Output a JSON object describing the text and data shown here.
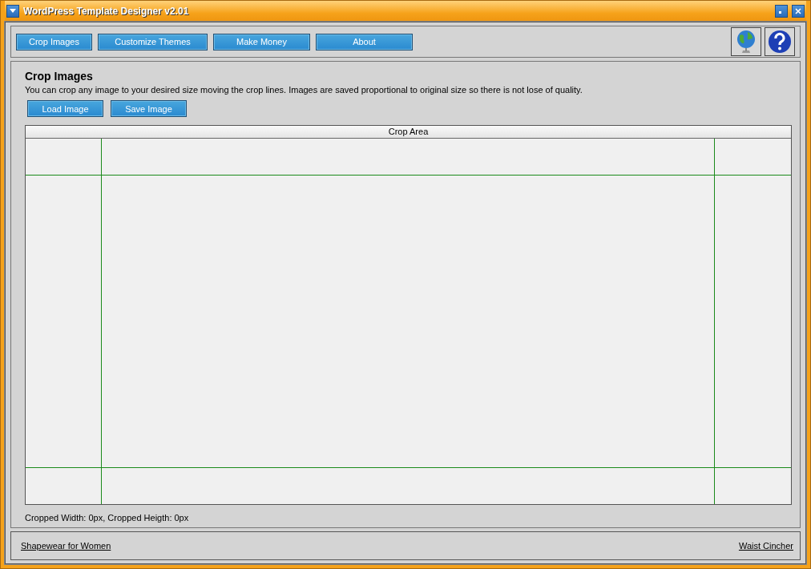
{
  "window": {
    "title": "WordPress Template Designer v2.01"
  },
  "nav_buttons": [
    {
      "label": "Crop Images"
    },
    {
      "label": "Customize Themes"
    },
    {
      "label": "Make Money"
    },
    {
      "label": "About"
    }
  ],
  "panel": {
    "title": "Crop Images",
    "description": "You can crop any image to your desired size moving the crop lines. Images are saved proportional to original size so there is not lose of quality.",
    "buttons": [
      {
        "label": "Load Image"
      },
      {
        "label": "Save Image"
      }
    ],
    "crop_area": {
      "header": "Crop Area"
    },
    "status": "Cropped Width: 0px, Cropped Heigth: 0px"
  },
  "footer": {
    "links": [
      {
        "label": "Shapewear for Women"
      },
      {
        "label": "Waist Cincher"
      }
    ]
  }
}
